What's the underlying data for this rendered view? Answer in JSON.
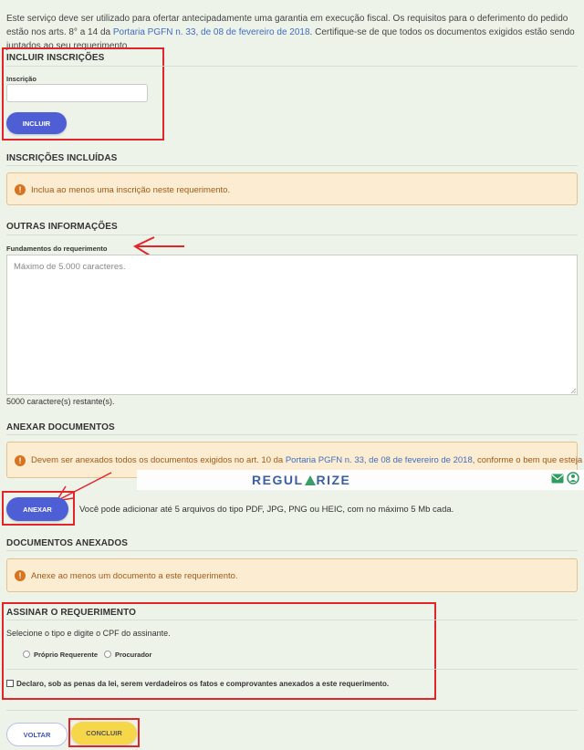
{
  "intro": {
    "text_before": "Este serviço deve ser utilizado para ofertar antecipadamente uma garantia em execução fiscal. Os requisitos para o deferimento do pedido estão nos arts. 8° a 14 da ",
    "link": "Portaria PGFN n. 33, de 08 de fevereiro de 2018",
    "text_after": ". Certifique-se de que todos os documentos exigidos estão sendo juntados ao seu requerimento."
  },
  "incluir": {
    "title": "INCLUIR INSCRIÇÕES",
    "field_label": "Inscrição",
    "input_value": "",
    "button": "INCLUIR"
  },
  "incluidas": {
    "title": "INSCRIÇÕES INCLUÍDAS",
    "alert": "Inclua ao menos uma inscrição neste requerimento."
  },
  "outras": {
    "title": "OUTRAS INFORMAÇÕES",
    "field_label": "Fundamentos do requerimento",
    "placeholder": "Máximo de 5.000 caracteres.",
    "remaining": "5000 caractere(s) restante(s)."
  },
  "anexar": {
    "title": "ANEXAR DOCUMENTOS",
    "alert_before": "Devem ser anexados todos os documentos exigidos no art. 10 da ",
    "alert_link": "Portaria PGFN n. 33, de 08 de fevereiro de 2018",
    "alert_after": ", conforme o bem que esteja",
    "button": "ANEXAR",
    "hint": "Você pode adicionar até 5 arquivos do tipo PDF, JPG, PNG ou HEIC, com no máximo 5 Mb cada."
  },
  "banner": {
    "logo_left": "REGUL",
    "logo_right": "RIZE",
    "icons": [
      "mail-icon",
      "whatsapp-icon"
    ]
  },
  "anexados": {
    "title": "DOCUMENTOS ANEXADOS",
    "alert": "Anexe ao menos um documento a este requerimento."
  },
  "assinar": {
    "title": "ASSINAR O REQUERIMENTO",
    "instruction": "Selecione o tipo e digite o CPF do assinante.",
    "option1": "Próprio Requerente",
    "option2": "Procurador",
    "declaration": "Declaro, sob as penas da lei, serem verdadeiros os fatos e comprovantes anexados a este requerimento."
  },
  "footer": {
    "back": "VOLTAR",
    "submit": "CONCLUIR"
  },
  "colors": {
    "accent": "#4e5fd6",
    "highlight": "#e2252b",
    "warning_bg": "#fbecd2",
    "submit": "#f6d74a"
  }
}
